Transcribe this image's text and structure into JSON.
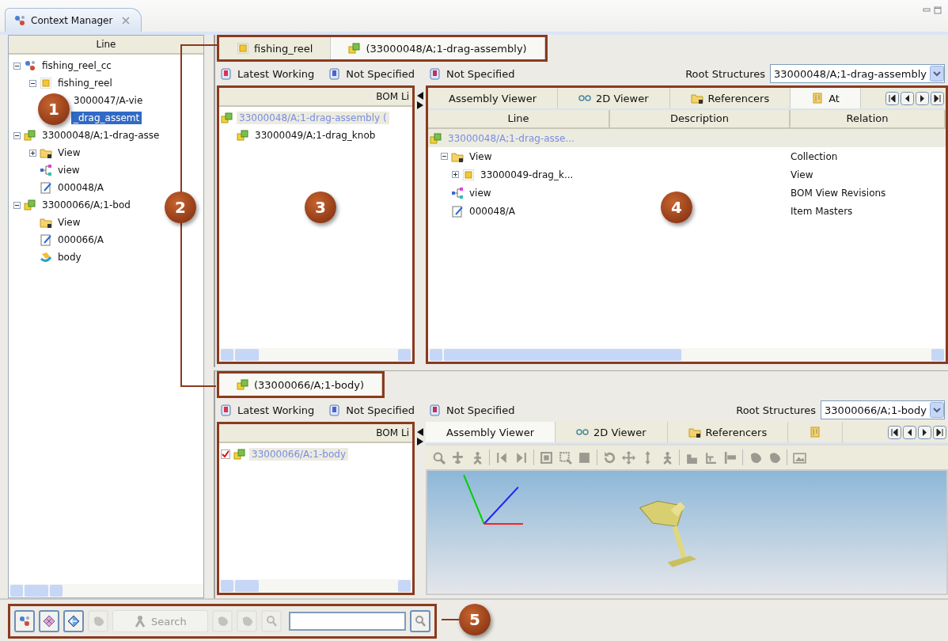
{
  "view_tab": {
    "title": "Context Manager"
  },
  "left_panel": {
    "column": "Line",
    "tree": [
      {
        "label": "fishing_reel_cc",
        "kind": "context",
        "expanded": true,
        "selected": false,
        "children": [
          {
            "label": "fishing_reel",
            "kind": "item",
            "expanded": true,
            "selected": false,
            "children": [
              {
                "label": "3000047/A-vie",
                "selected": false
              },
              {
                "label": "_drag_assemt",
                "selected": true
              }
            ]
          }
        ]
      },
      {
        "label": "33000048/A;1-drag-asse",
        "kind": "assembly",
        "expanded": true,
        "selected": false,
        "children": [
          {
            "label": "View",
            "kind": "folder",
            "expanded": false,
            "selected": false
          },
          {
            "label": "view",
            "kind": "bomview",
            "selected": false
          },
          {
            "label": "000048/A",
            "kind": "form",
            "selected": false
          }
        ]
      },
      {
        "label": "33000066/A;1-bod",
        "kind": "assembly",
        "expanded": true,
        "selected": false,
        "children": [
          {
            "label": "View",
            "kind": "folder",
            "selected": false
          },
          {
            "label": "000066/A",
            "kind": "form",
            "selected": false
          },
          {
            "label": "body",
            "kind": "model",
            "selected": false
          }
        ]
      }
    ]
  },
  "sections": [
    {
      "tabs": [
        {
          "label": "fishing_reel",
          "kind": "item",
          "selected": false
        },
        {
          "label": "(33000048/A;1-drag-assembly)",
          "kind": "assembly",
          "selected": true
        }
      ],
      "toolbar": {
        "rules": [
          {
            "kind": "revision",
            "label": "Latest Working"
          },
          {
            "kind": "effectivity",
            "label": "Not Specified"
          },
          {
            "kind": "variant",
            "label": "Not Specified"
          }
        ],
        "root_label": "Root Structures",
        "root_value": "33000048/A;1-drag-assembly"
      },
      "bom": {
        "column": "BOM Li",
        "tree": [
          {
            "label": "33000048/A;1-drag-assembly (",
            "kind": "assembly",
            "selected": true,
            "children": [
              {
                "label": "33000049/A;1-drag_knob",
                "kind": "assembly",
                "selected": false
              }
            ]
          }
        ]
      },
      "viewer": {
        "kind": "table",
        "tabs": [
          {
            "label": "Assembly Viewer",
            "kind": "plain",
            "selected": false
          },
          {
            "label": "2D Viewer",
            "kind": "glasses",
            "selected": false
          },
          {
            "label": "Referencers",
            "kind": "folder",
            "selected": false
          },
          {
            "label": "At",
            "kind": "clip",
            "selected": true
          }
        ],
        "columns": [
          "Line",
          "Description",
          "Relation"
        ],
        "tree": [
          {
            "label": "33000048/A;1-drag-asse...",
            "kind": "assembly",
            "selected": true,
            "children": [
              {
                "label": "View",
                "kind": "folder",
                "expanded": true,
                "selected": false,
                "relation": "Collection",
                "children": [
                  {
                    "label": "33000049-drag_k...",
                    "kind": "item",
                    "expanded": false,
                    "selected": false,
                    "relation": "View"
                  }
                ]
              },
              {
                "label": "view",
                "kind": "bomview",
                "selected": false,
                "relation": "BOM View Revisions"
              },
              {
                "label": "000048/A",
                "kind": "form",
                "selected": false,
                "relation": "Item Masters"
              }
            ]
          }
        ]
      }
    },
    {
      "tabs": [
        {
          "label": "(33000066/A;1-body)",
          "kind": "assembly",
          "selected": true
        }
      ],
      "toolbar": {
        "rules": [
          {
            "kind": "revision",
            "label": "Latest Working"
          },
          {
            "kind": "effectivity",
            "label": "Not Specified"
          },
          {
            "kind": "variant",
            "label": "Not Specified"
          }
        ],
        "root_label": "Root Structures",
        "root_value": "33000066/A;1-body"
      },
      "bom": {
        "column": "BOM Li",
        "tree": [
          {
            "label": "33000066/A;1-body",
            "kind": "assembly",
            "selected": true,
            "checked": true
          }
        ]
      },
      "viewer": {
        "kind": "viewport",
        "tabs": [
          {
            "label": "Assembly Viewer",
            "kind": "plain",
            "selected": true
          },
          {
            "label": "2D Viewer",
            "kind": "glasses",
            "selected": false
          },
          {
            "label": "Referencers",
            "kind": "folder",
            "selected": false
          },
          {
            "kind": "clip",
            "selected": false
          }
        ]
      }
    }
  ],
  "bottom_toolbar": {
    "buttons": [
      {
        "kind": "context",
        "disabled": false
      },
      {
        "kind": "grid",
        "disabled": false
      },
      {
        "kind": "arrow",
        "disabled": false
      },
      {
        "kind": "blob",
        "disabled": true
      }
    ],
    "search": {
      "label": "Search",
      "disabled": true
    },
    "tools": [
      {
        "kind": "blob",
        "disabled": true
      },
      {
        "kind": "blob",
        "disabled": true
      },
      {
        "kind": "magnifier",
        "disabled": true
      }
    ],
    "find_disabled": false
  },
  "callouts": [
    "1",
    "2",
    "3",
    "4",
    "5"
  ]
}
